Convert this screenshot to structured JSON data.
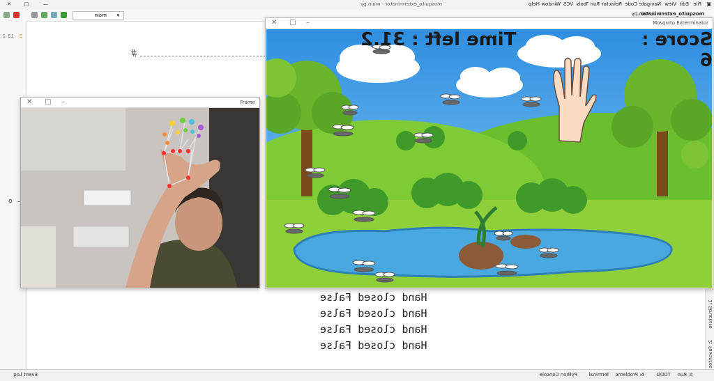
{
  "ide": {
    "window_title": "mosquito_exterminator - main.py",
    "project_label": "mosquito_exterminator",
    "file_label": "main.py",
    "menu": [
      "File",
      "Edit",
      "View",
      "Navigate",
      "Code",
      "Refactor",
      "Run",
      "Tools",
      "VCS",
      "Window",
      "Help"
    ],
    "run_config": "main",
    "console_lines": [
      "Hand closed False",
      "Hand closed False",
      "Hand closed False",
      "Hand closed False"
    ],
    "editor_hash": "#",
    "gutter_labels": {
      "warn": "2",
      "count1": "13",
      "count2": "2"
    },
    "statusbar": {
      "run": "4: Run",
      "todo": "TODO",
      "problems": "6: Problems",
      "terminal": "Terminal",
      "python_console": "Python Console",
      "event_log": "Event Log"
    },
    "side_tabs": [
      "1: Structure",
      "2: Favorites"
    ]
  },
  "game": {
    "window_title": "Mosquito Exterminator",
    "score_text": "Score : 6",
    "time_text": "Time left : 31.2"
  },
  "camera": {
    "window_title": "Frame"
  },
  "colors": {
    "sky": "#3e9ee8",
    "grass": "#8fcf3a",
    "pond": "#4aa8e0"
  }
}
